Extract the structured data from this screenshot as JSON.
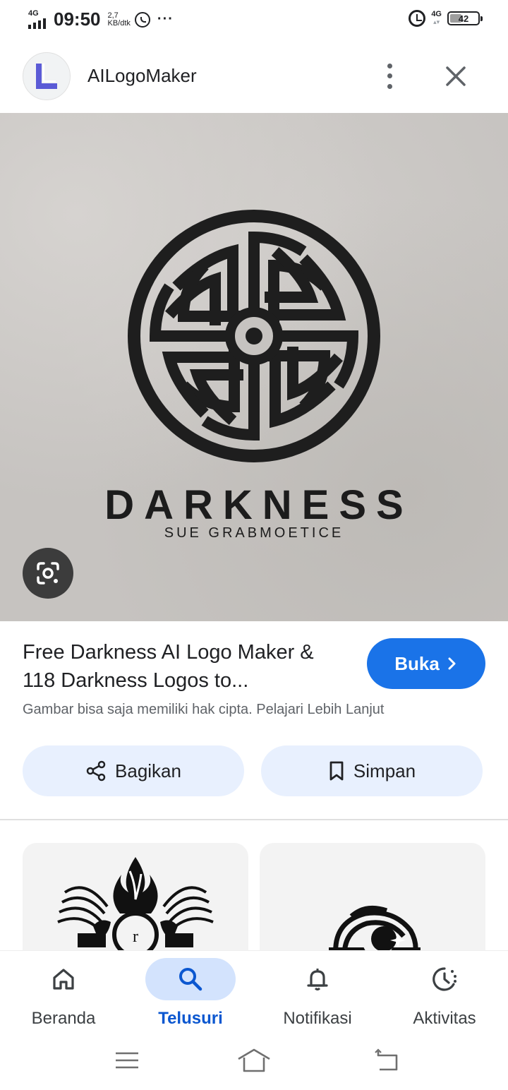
{
  "status_bar": {
    "network_left": "4G",
    "time": "09:50",
    "speed_value": "2,7",
    "speed_unit": "KB/dtk",
    "network_right": "4G",
    "battery": "42",
    "battery_level": 0.42
  },
  "header": {
    "site_name": "AILogoMaker"
  },
  "hero": {
    "logo_title": "DARKNESS",
    "logo_subtitle": "SUE GRABMOETICE"
  },
  "result": {
    "title": "Free Darkness AI Logo Maker & 118 Darkness Logos to...",
    "open_label": "Buka",
    "copyright_note": "Gambar bisa saja memiliki hak cipta. Pelajari Lebih Lanjut"
  },
  "actions": {
    "share_label": "Bagikan",
    "save_label": "Simpan"
  },
  "bottom_nav": {
    "items": [
      {
        "label": "Beranda",
        "icon": "home-icon"
      },
      {
        "label": "Telusuri",
        "icon": "search-icon"
      },
      {
        "label": "Notifikasi",
        "icon": "bell-icon"
      },
      {
        "label": "Aktivitas",
        "icon": "history-icon"
      }
    ],
    "active_index": 1
  },
  "colors": {
    "accent": "#1a73e8",
    "active_tab": "#0b57d0",
    "chip_background": "#e8f0fe"
  }
}
